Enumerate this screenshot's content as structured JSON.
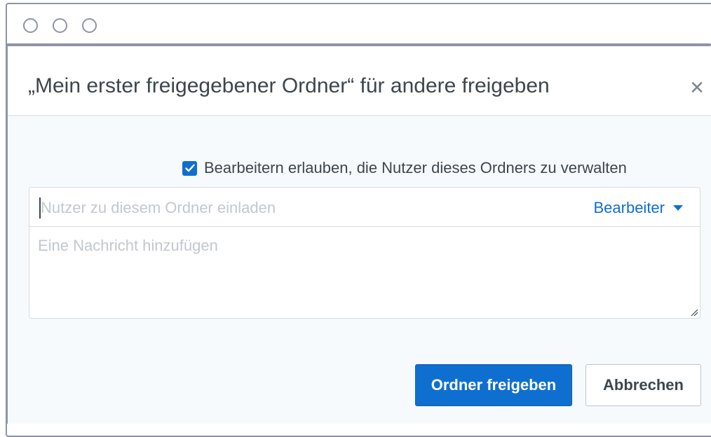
{
  "window": {
    "controls": [
      "window-dot",
      "window-dot",
      "window-dot"
    ]
  },
  "dialog": {
    "title": "„Mein erster freigegebener Ordner“ für andere freigeben",
    "close_icon": "×"
  },
  "permissions": {
    "checked": true,
    "label": "Bearbeitern erlauben, die Nutzer dieses Ordners zu verwalten"
  },
  "invite": {
    "placeholder": "Nutzer zu diesem Ordner einladen",
    "role_selected": "Bearbeiter",
    "message_placeholder": "Eine Nachricht hinzufügen"
  },
  "actions": {
    "share_label": "Ordner freigeben",
    "cancel_label": "Abbrechen"
  },
  "colors": {
    "accent": "#0f6fd0",
    "frame": "#8f93a8",
    "text": "#3d464d",
    "placeholder": "#c2c8ce"
  }
}
